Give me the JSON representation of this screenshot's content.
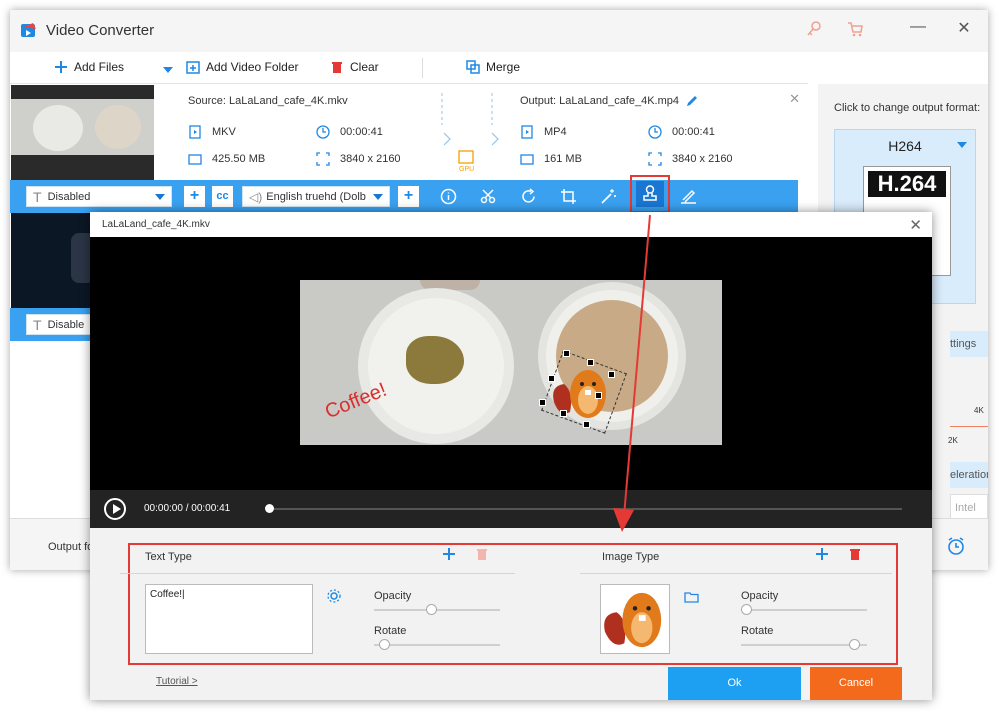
{
  "app": {
    "title": "Video Converter",
    "toolbar": {
      "add_files": "Add Files",
      "add_folder": "Add Video Folder",
      "clear": "Clear",
      "merge": "Merge"
    }
  },
  "file": {
    "source": "Source: LaLaLand_cafe_4K.mkv",
    "output": "Output: LaLaLand_cafe_4K.mp4",
    "src_format": "MKV",
    "src_duration": "00:00:41",
    "src_size": "425.50 MB",
    "src_resolution": "3840 x 2160",
    "out_format": "MP4",
    "out_duration": "00:00:41",
    "out_size": "161 MB",
    "out_resolution": "3840 x 2160",
    "gpu_label": "GPU"
  },
  "edit_bar": {
    "subtitle_select": "Disabled",
    "audio_select": "English truehd (Dolb",
    "subtitle_select_2": "Disable"
  },
  "right_panel": {
    "label": "Click to change output format:",
    "format": "H264",
    "format_badge": "H.264",
    "settings_partial": "ttings",
    "res_4k": "4K",
    "res_2k": "2K",
    "accel_partial": "eleration",
    "intel_partial": "Intel"
  },
  "bottom": {
    "output_partial": "Output fo"
  },
  "dialog": {
    "title": "LaLaLand_cafe_4K.mkv",
    "watermark_text_on_video": "Coffee!",
    "time_current": "00:00:00",
    "time_sep": "/",
    "time_total": "00:00:41",
    "progress": 0.0,
    "text_section": {
      "title": "Text Type",
      "text_value": "Coffee!|",
      "opacity_label": "Opacity",
      "opacity_value": 0.45,
      "rotate_label": "Rotate",
      "rotate_value": 0.08
    },
    "image_section": {
      "title": "Image Type",
      "opacity_label": "Opacity",
      "opacity_value": 0.04,
      "rotate_label": "Rotate",
      "rotate_value": 0.9
    },
    "tutorial": "Tutorial >",
    "ok": "Ok",
    "cancel": "Cancel"
  },
  "colors": {
    "accent_blue": "#3aa1f0",
    "highlight_red": "#e53935",
    "ok_blue": "#1ea0f2",
    "cancel_orange": "#f36a1c"
  }
}
